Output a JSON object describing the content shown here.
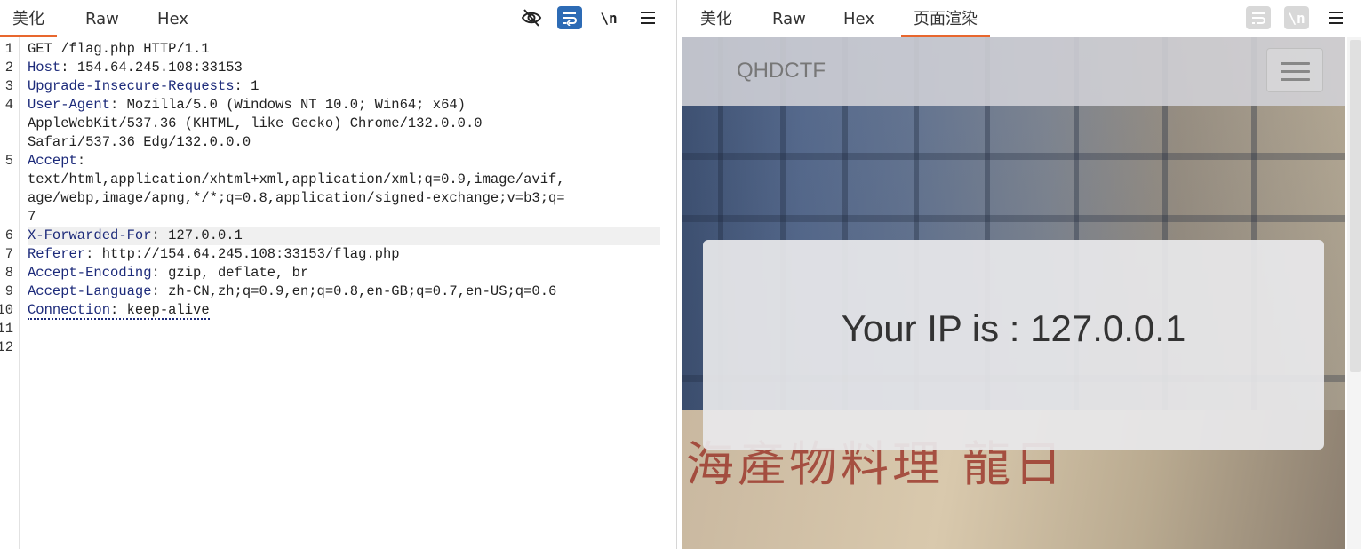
{
  "request_pane": {
    "tabs": [
      {
        "label": "美化"
      },
      {
        "label": "Raw"
      },
      {
        "label": "Hex"
      }
    ],
    "active_tab": "美化",
    "toolbar": {
      "newline_label": "\\n",
      "icons": [
        "eye-slash-icon",
        "wrap-icon",
        "newline-icon",
        "menu-icon"
      ]
    },
    "line_numbers": [
      "1",
      "2",
      "3",
      "4",
      "",
      "",
      "5",
      "",
      "",
      "",
      "6",
      "7",
      "8",
      "9",
      "10",
      "11",
      "12"
    ],
    "lines": {
      "l1": "GET /flag.php HTTP/1.1",
      "l2_name": "Host",
      "l2_value": ": 154.64.245.108:33153",
      "l3_name": "Upgrade-Insecure-Requests",
      "l3_value": ": 1",
      "l4_name": "User-Agent",
      "l4_value": ": Mozilla/5.0 (Windows NT 10.0; Win64; x64)",
      "l4_cont1": "AppleWebKit/537.36 (KHTML, like Gecko) Chrome/132.0.0.0",
      "l4_cont2": "Safari/537.36 Edg/132.0.0.0",
      "l5_name": "Accept",
      "l5_value": ":",
      "l5_cont1": "text/html,application/xhtml+xml,application/xml;q=0.9,image/avif,",
      "l5_cont2": "age/webp,image/apng,*/*;q=0.8,application/signed-exchange;v=b3;q=",
      "l5_cont3": "7",
      "l6_name": "X-Forwarded-For",
      "l6_value": ": 127.0.0.1",
      "l7_name": "Referer",
      "l7_value": ": http://154.64.245.108:33153/flag.php",
      "l8_name": "Accept-Encoding",
      "l8_value": ": gzip, deflate, br",
      "l9_name": "Accept-Language",
      "l9_value": ": zh-CN,zh;q=0.9,en;q=0.8,en-GB;q=0.7,en-US;q=0.6",
      "l10_name": "Connection",
      "l10_value": ": keep-alive"
    }
  },
  "response_pane": {
    "tabs": [
      {
        "label": "美化"
      },
      {
        "label": "Raw"
      },
      {
        "label": "Hex"
      },
      {
        "label": "页面渲染"
      }
    ],
    "active_tab": "页面渲染",
    "toolbar": {
      "newline_label": "\\n",
      "icons": [
        "wrap-icon",
        "newline-icon",
        "menu-icon"
      ]
    },
    "rendered_page": {
      "brand": "QHDCTF",
      "message": "Your IP is : 127.0.0.1",
      "banner_text": "海產物料理 龍日"
    }
  },
  "colors": {
    "accent_tab": "#e8672e",
    "toolbar_active": "#2d6bb5",
    "header_name": "#1c2a7a"
  }
}
